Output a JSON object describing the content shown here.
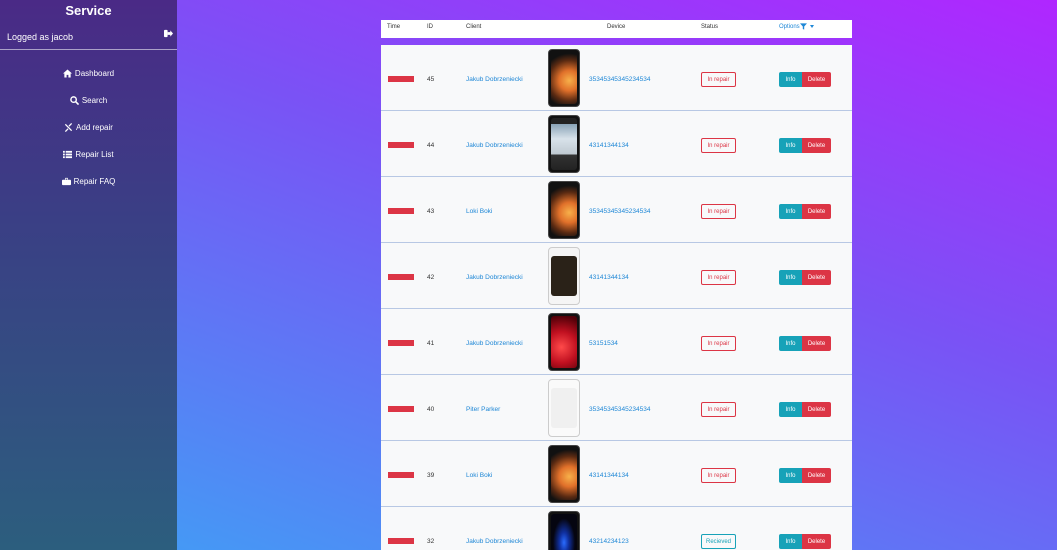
{
  "sidebar": {
    "brand": "Service",
    "user_label": "Logged as jacob",
    "nav": [
      {
        "label": "Dashboard",
        "icon": "home-icon"
      },
      {
        "label": "Search",
        "icon": "search-icon"
      },
      {
        "label": "Add repair",
        "icon": "tools-icon"
      },
      {
        "label": "Repair List",
        "icon": "list-icon"
      },
      {
        "label": "Repair FAQ",
        "icon": "toolbox-icon"
      }
    ]
  },
  "table": {
    "headers": {
      "time": "Time",
      "id": "ID",
      "client": "Client",
      "device": "Device",
      "status": "Status",
      "options": "Options"
    },
    "info_label": "Info",
    "delete_label": "Delete",
    "rows": [
      {
        "id": "45",
        "client": "Jakub Dobrzeniecki",
        "device": "35345345345234534",
        "status": "In repair",
        "phone": "xs"
      },
      {
        "id": "44",
        "client": "Jakub Dobrzeniecki",
        "device": "43141344134",
        "status": "In repair",
        "phone": "classic-black"
      },
      {
        "id": "43",
        "client": "Loki Boki",
        "device": "35345345345234534",
        "status": "In repair",
        "phone": "xs"
      },
      {
        "id": "42",
        "client": "Jakub Dobrzeniecki",
        "device": "43141344134",
        "status": "In repair",
        "phone": "white-dark"
      },
      {
        "id": "41",
        "client": "Jakub Dobrzeniecki",
        "device": "53151534",
        "status": "In repair",
        "phone": "xr-red"
      },
      {
        "id": "40",
        "client": "Piter Parker",
        "device": "35345345345234534",
        "status": "In repair",
        "phone": "white-light"
      },
      {
        "id": "39",
        "client": "Loki Boki",
        "device": "43141344134",
        "status": "In repair",
        "phone": "xs"
      },
      {
        "id": "32",
        "client": "Jakub Dobrzeniecki",
        "device": "43214234123",
        "status": "Recieved",
        "phone": "dark-blue"
      }
    ]
  },
  "colors": {
    "accent": "#1e87d6",
    "danger": "#dc3545",
    "info": "#17a2b8"
  }
}
